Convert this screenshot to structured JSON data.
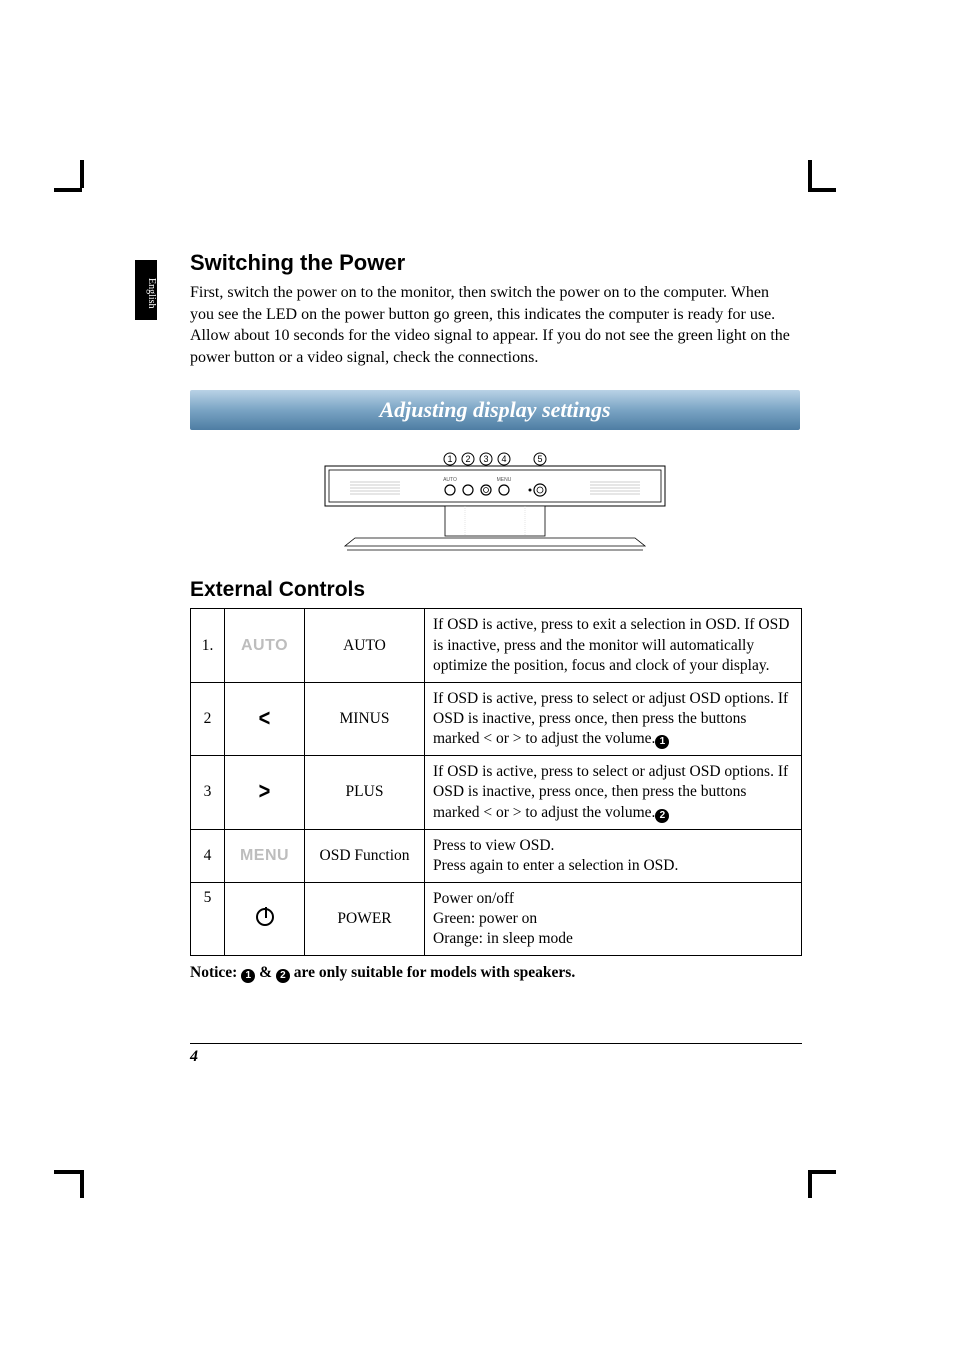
{
  "side_tab": "English",
  "section1": {
    "heading": "Switching the Power",
    "body": "First, switch the power on to the monitor, then switch the power on to the computer. When you see the LED on the power button go green, this indicates the computer is ready for use. Allow about 10 seconds for the video signal to appear. If you do not see the green light on the power button or a video signal, check the connections."
  },
  "banner": "Adjusting display settings",
  "diagram": {
    "callouts": [
      "1",
      "2",
      "3",
      "4",
      "5"
    ],
    "btn_labels": [
      "AUTO",
      "<",
      ">",
      "MENU",
      "POWER"
    ]
  },
  "section2_heading": "External Controls",
  "controls": [
    {
      "num": "1.",
      "icon": "auto",
      "icon_text": "AUTO",
      "name": "AUTO",
      "desc": "If OSD is active, press to exit a selection in OSD. If OSD is inactive, press and the monitor will automatically optimize the position, focus and clock of your display."
    },
    {
      "num": "2",
      "icon": "lt",
      "icon_text": "<",
      "name": "MINUS",
      "desc_prefix": "If OSD is active, press to select or adjust OSD options. If OSD is inactive, press once, then press the buttons marked < or > to adjust the volume.",
      "sym": "1"
    },
    {
      "num": "3",
      "icon": "gt",
      "icon_text": ">",
      "name": "PLUS",
      "desc_prefix": "If OSD is active, press to select or adjust OSD options. If OSD is inactive, press once, then press the buttons marked < or > to adjust the volume.",
      "sym": "2"
    },
    {
      "num": "4",
      "icon": "menu",
      "icon_text": "MENU",
      "name": "OSD Function",
      "desc": "Press to view OSD.\nPress again to enter a selection in OSD."
    },
    {
      "num": "5",
      "icon": "power",
      "icon_text": "",
      "name": "POWER",
      "desc": "Power on/off\nGreen: power on\nOrange: in sleep mode"
    }
  ],
  "notice": {
    "prefix": "Notice: ",
    "sym1": "1",
    "amp": " & ",
    "sym2": "2",
    "suffix": " are only suitable for models with speakers."
  },
  "page_number": "4"
}
